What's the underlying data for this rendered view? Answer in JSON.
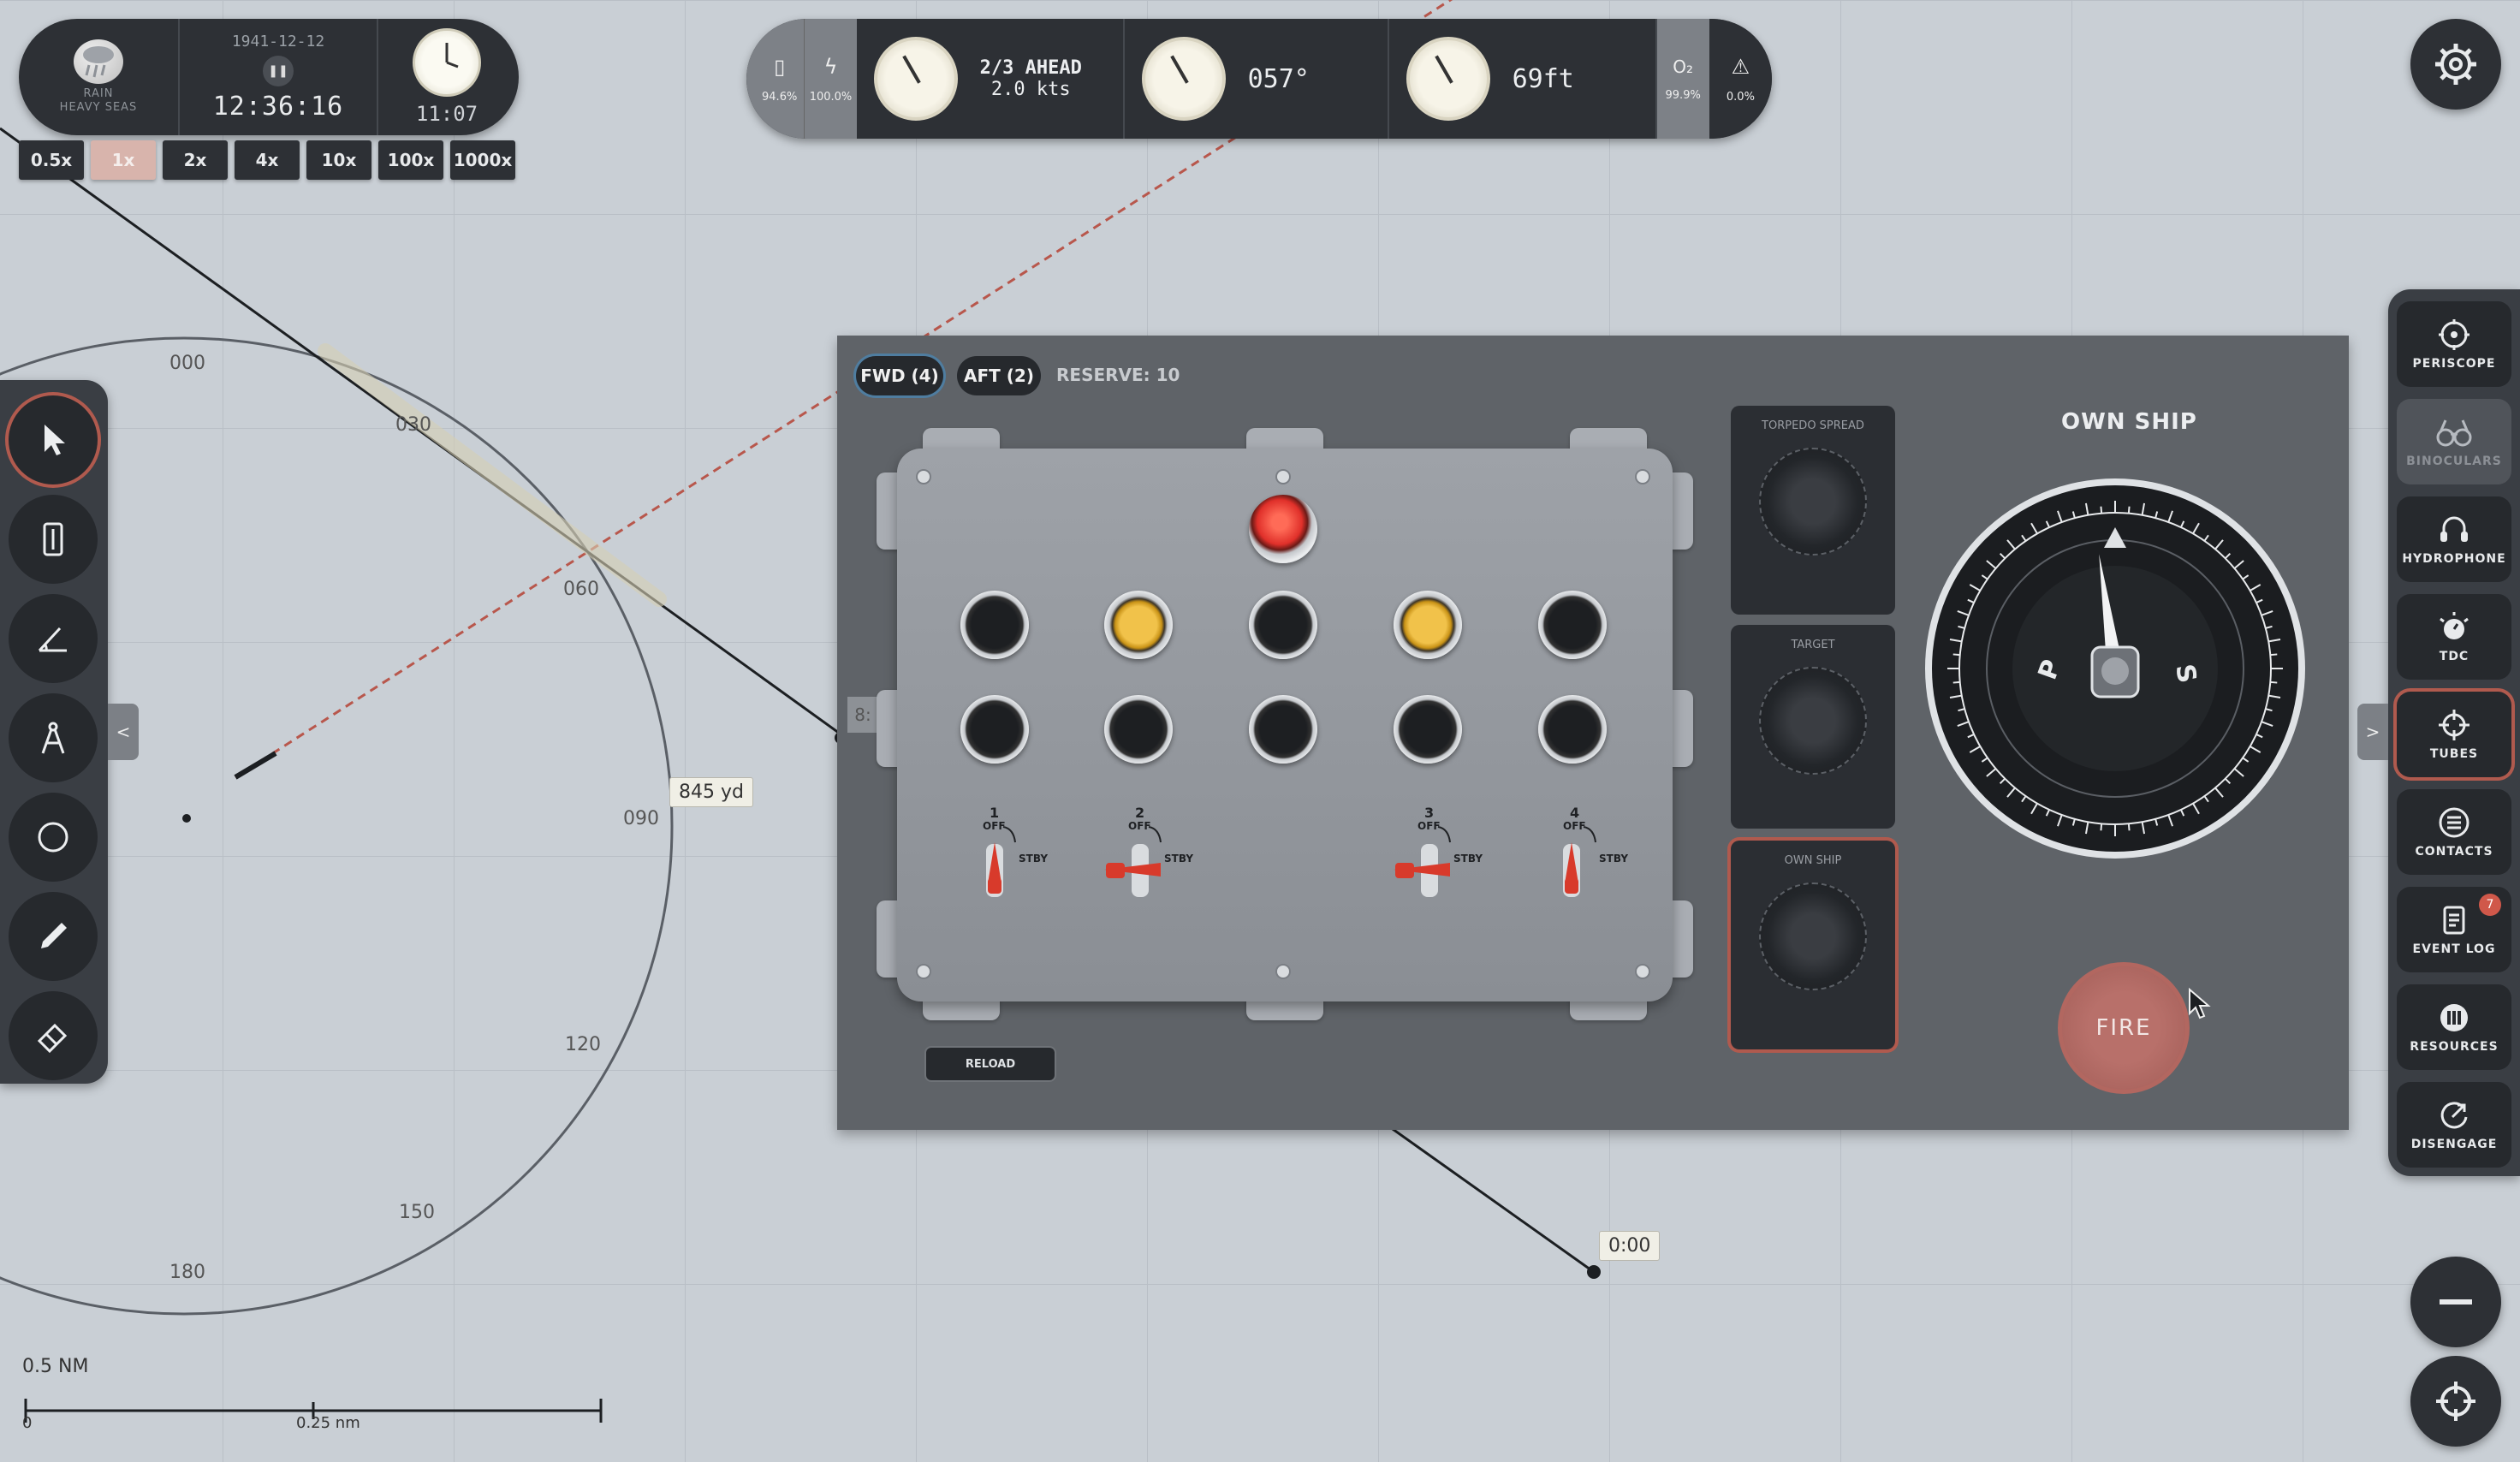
{
  "clock": {
    "weather_line1": "RAIN",
    "weather_line2": "HEAVY SEAS",
    "date": "1941-12-12",
    "pause_icon": "pause-icon",
    "time": "12:36:16",
    "local_time": "11:07"
  },
  "time_scale": {
    "options": [
      "0.5x",
      "1x",
      "2x",
      "4x",
      "10x",
      "100x",
      "1000x"
    ],
    "selected": "1x"
  },
  "instruments": {
    "battery_pct": "94.6%",
    "power_pct": "100.0%",
    "telegraph_order": "2/3 AHEAD",
    "speed": "2.0 kts",
    "heading": "057°",
    "depth": "69ft",
    "oxygen_symbol": "O₂",
    "oxygen_pct": "99.9%",
    "damage_pct": "0.0%"
  },
  "chart": {
    "bearing_labels": [
      "000",
      "030",
      "060",
      "090",
      "120",
      "150",
      "180"
    ],
    "range_label": "845 yd",
    "time_label": "0:00",
    "marker_label": "8:",
    "scale_title": "0.5 NM",
    "scale_zero": "0",
    "scale_mid": "0.25 nm"
  },
  "torpedo": {
    "tab_fwd": "FWD (4)",
    "tab_aft": "AFT (2)",
    "reserve": "RESERVE: 10",
    "tubes": [
      {
        "num": "1",
        "off": "OFF",
        "stby": "STBY"
      },
      {
        "num": "2",
        "off": "OFF",
        "stby": "STBY"
      },
      {
        "num": "3",
        "off": "OFF",
        "stby": "STBY"
      },
      {
        "num": "4",
        "off": "OFF",
        "stby": "STBY"
      }
    ],
    "reload": "RELOAD",
    "spread_title": "TORPEDO SPREAD",
    "target_title": "TARGET",
    "ownship_title": "OWN SHIP",
    "dial_title": "OWN SHIP",
    "dial_port": "P",
    "dial_starboard": "S",
    "fire": "FIRE"
  },
  "sidebar": {
    "expand_symbol": ">",
    "items": [
      {
        "label": "PERISCOPE",
        "icon": "periscope-icon"
      },
      {
        "label": "BINOCULARS",
        "icon": "binoculars-icon"
      },
      {
        "label": "HYDROPHONE",
        "icon": "hydrophone-icon"
      },
      {
        "label": "TDC",
        "icon": "tdc-icon"
      },
      {
        "label": "TUBES",
        "icon": "tubes-icon"
      },
      {
        "label": "CONTACTS",
        "icon": "contacts-icon"
      },
      {
        "label": "EVENT LOG",
        "icon": "event-log-icon",
        "badge": "7"
      },
      {
        "label": "RESOURCES",
        "icon": "resources-icon"
      },
      {
        "label": "DISENGAGE",
        "icon": "disengage-icon"
      }
    ]
  },
  "toolbar": {
    "collapse_symbol": "<",
    "tools": [
      "pointer-icon",
      "ruler-icon",
      "protractor-icon",
      "compass-icon",
      "circle-icon",
      "pencil-icon",
      "eraser-icon"
    ]
  },
  "colors": {
    "accent_red": "#b05a4e",
    "tab_active_blue": "#4f7da0",
    "panel": "#5f6368",
    "dark": "#2d3035"
  }
}
